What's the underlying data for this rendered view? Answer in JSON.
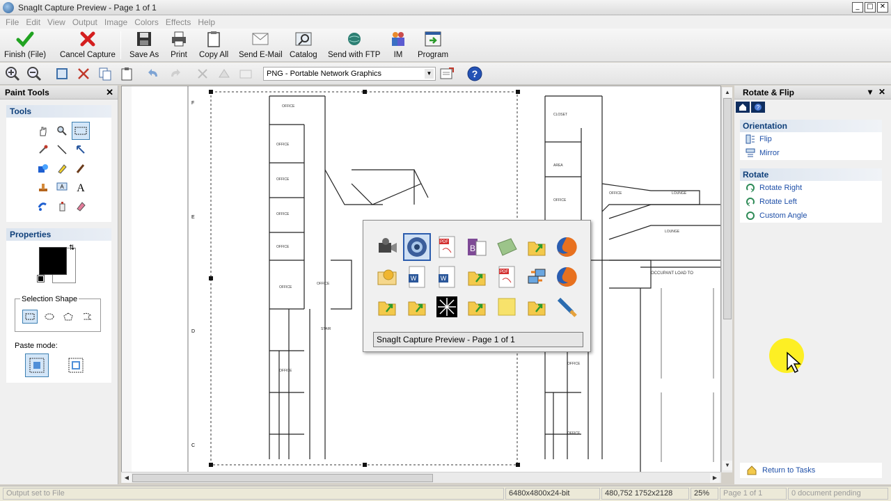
{
  "window": {
    "title": "SnagIt Capture Preview - Page 1 of 1"
  },
  "menu": [
    "File",
    "Edit",
    "View",
    "Output",
    "Image",
    "Colors",
    "Effects",
    "Help"
  ],
  "toolbar": [
    {
      "label": "Finish (File)",
      "icon": "check-icon"
    },
    {
      "label": "Cancel Capture",
      "icon": "cancel-x-icon"
    },
    {
      "label": "Save As",
      "icon": "floppy-icon"
    },
    {
      "label": "Print",
      "icon": "printer-icon"
    },
    {
      "label": "Copy All",
      "icon": "clipboard-icon"
    },
    {
      "label": "Send E-Mail",
      "icon": "envelope-icon"
    },
    {
      "label": "Catalog",
      "icon": "catalog-icon"
    },
    {
      "label": "Send with FTP",
      "icon": "ftp-globe-icon"
    },
    {
      "label": "IM",
      "icon": "im-buddies-icon"
    },
    {
      "label": "Program",
      "icon": "program-icon"
    }
  ],
  "format": {
    "selected": "PNG - Portable Network Graphics"
  },
  "paint_tools": {
    "title": "Paint Tools",
    "tools_title": "Tools",
    "properties_title": "Properties",
    "selection_shape_label": "Selection Shape",
    "paste_mode_label": "Paste mode:",
    "fill_color": "#000000"
  },
  "popup": {
    "caption": "SnagIt Capture Preview - Page 1 of 1"
  },
  "rotate_panel": {
    "title": "Rotate & Flip",
    "orientation_title": "Orientation",
    "orientation_items": [
      "Flip",
      "Mirror"
    ],
    "rotate_title": "Rotate",
    "rotate_items": [
      "Rotate Right",
      "Rotate Left",
      "Custom Angle"
    ],
    "return_label": "Return to Tasks"
  },
  "status": {
    "output": "Output set to File",
    "image_info": "6480x4800x24-bit",
    "cursor_info": "480,752  1752x2128",
    "zoom": "25%",
    "page": "Page 1 of 1",
    "pending": "0 document pending"
  },
  "colors": {
    "link": "#1e4fa8",
    "section": "#0e3f7a",
    "highlight": "#ffef00"
  }
}
